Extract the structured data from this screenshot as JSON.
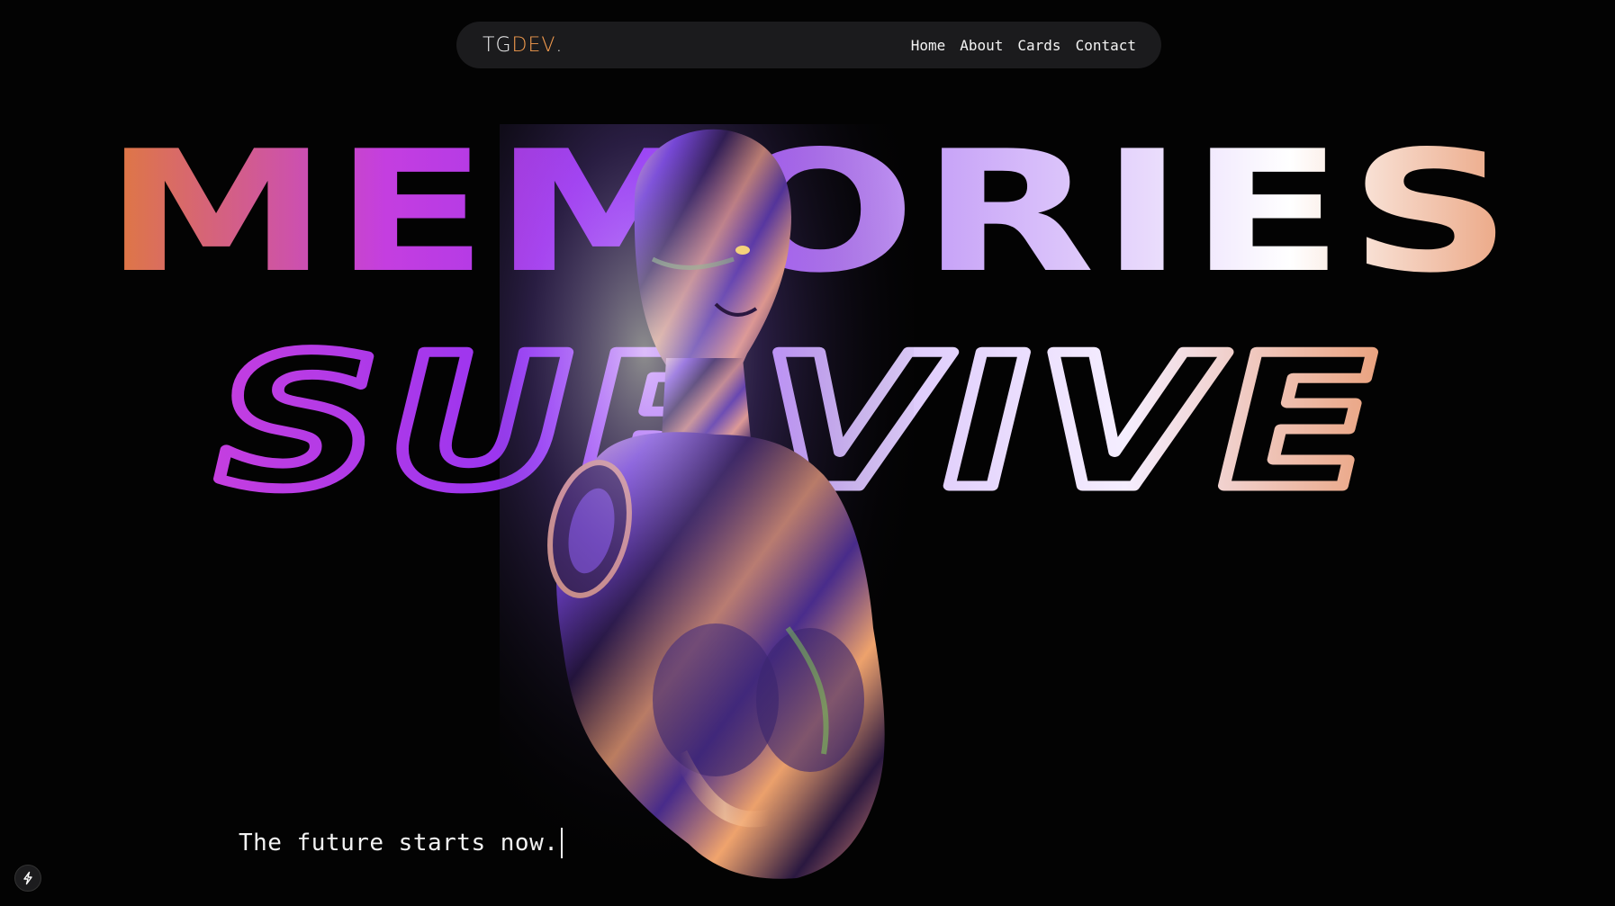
{
  "nav": {
    "logo": {
      "part1": "TG",
      "part2": "DEV",
      "part3": "."
    },
    "links": [
      {
        "label": "Home"
      },
      {
        "label": "About"
      },
      {
        "label": "Cards"
      },
      {
        "label": "Contact"
      }
    ]
  },
  "hero": {
    "line1": "MEMORIES",
    "line2": "SURVIVE",
    "tagline": "The future starts now."
  },
  "badge": {
    "icon": "bolt-icon"
  },
  "colors": {
    "background": "#030303",
    "nav_background": "#1b1b1d",
    "logo_accent": "#f29b4e",
    "gradient_start": "#e07a3c",
    "gradient_mid1": "#c43ee0",
    "gradient_mid2": "#9a35f0",
    "gradient_mid3": "#d9c3fb",
    "gradient_light": "#ffffff",
    "gradient_end": "#eaa27e"
  }
}
